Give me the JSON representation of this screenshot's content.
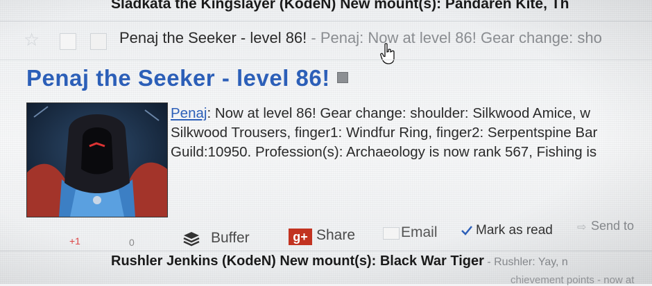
{
  "colors": {
    "link_blue": "#2c5fb8",
    "share_red": "#c23321",
    "snippet_gray": "#8a8d91"
  },
  "top_item": {
    "text": "Sladkata the Kingslayer (KodeN) New mount(s): Pandaren Kite, Th"
  },
  "selected_item": {
    "title": "Penaj the Seeker - level 86!",
    "snippet": " - Penaj: Now at level 86! Gear change: sho"
  },
  "article": {
    "title": "Penaj the Seeker - level 86!",
    "external_icon": "external-link-icon",
    "author_link": "Penaj",
    "line1_rest": ": Now at level 86! Gear change: shoulder: Silkwood Amice, w",
    "line2": "Silkwood Trousers, finger1: Windfur Ring, finger2: Serpentspine Bar",
    "line3": "Guild:10950. Profession(s): Archaeology is now rank 567, Fishing is"
  },
  "actions": {
    "plus_one": "+1",
    "plus_one_count": "0",
    "buffer_label": "Buffer",
    "share_icon_text": "g+",
    "share_label": "Share",
    "email_label": "Email",
    "mark_as_read_label": "Mark as read",
    "send_to_label": "Send to"
  },
  "next_item": {
    "title": "Rushler Jenkins (KodeN) New mount(s): Black War Tiger",
    "snippet": " - Rushler: Yay, n",
    "snippet2": "chievement points - now at"
  }
}
